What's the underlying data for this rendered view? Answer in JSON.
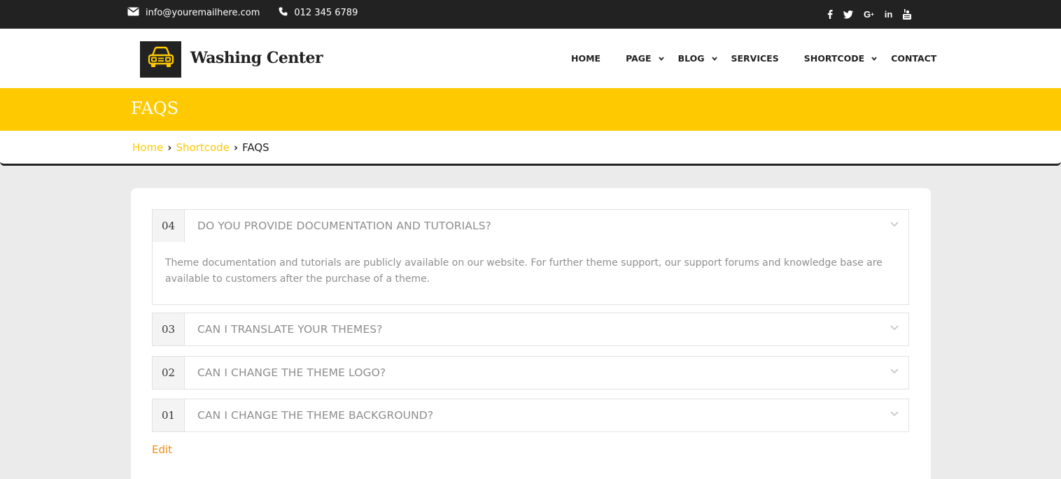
{
  "topbar": {
    "email": "info@youremailhere.com",
    "phone": "012 345 6789",
    "social": [
      {
        "icon": "facebook-icon",
        "glyph": "f"
      },
      {
        "icon": "twitter-icon",
        "glyph": "🐦"
      },
      {
        "icon": "google-plus-icon",
        "glyph": "G+"
      },
      {
        "icon": "linkedin-icon",
        "glyph": "in"
      },
      {
        "icon": "youtube-icon",
        "glyph": "▶"
      }
    ]
  },
  "header": {
    "brand": "Washing Center",
    "logo_icon": "car-icon",
    "nav": [
      {
        "label": "HOME",
        "dropdown": false
      },
      {
        "label": "PAGE",
        "dropdown": true
      },
      {
        "label": "BLOG",
        "dropdown": true
      },
      {
        "label": "SERVICES",
        "dropdown": false
      },
      {
        "label": "SHORTCODE",
        "dropdown": true
      },
      {
        "label": "CONTACT",
        "dropdown": false
      }
    ]
  },
  "banner": {
    "title": "FAQS"
  },
  "breadcrumb": {
    "home": "Home",
    "section": "Shortcode",
    "current": "FAQS",
    "separator": "›"
  },
  "faqs": [
    {
      "number": "04",
      "question": "DO YOU PROVIDE DOCUMENTATION AND TUTORIALS?",
      "expanded": true,
      "answer": "Theme documentation and tutorials are publicly available on our website. For further theme support, our support forums and knowledge base are available to customers after the purchase of a theme."
    },
    {
      "number": "03",
      "question": "CAN I TRANSLATE YOUR THEMES?",
      "expanded": false
    },
    {
      "number": "02",
      "question": "CAN I CHANGE THE THEME LOGO?",
      "expanded": false
    },
    {
      "number": "01",
      "question": "CAN I CHANGE THE THEME BACKGROUND?",
      "expanded": false
    }
  ],
  "edit_label": "Edit",
  "colors": {
    "accent": "#fec901",
    "dark": "#222222",
    "edit_link": "#f28c11"
  }
}
